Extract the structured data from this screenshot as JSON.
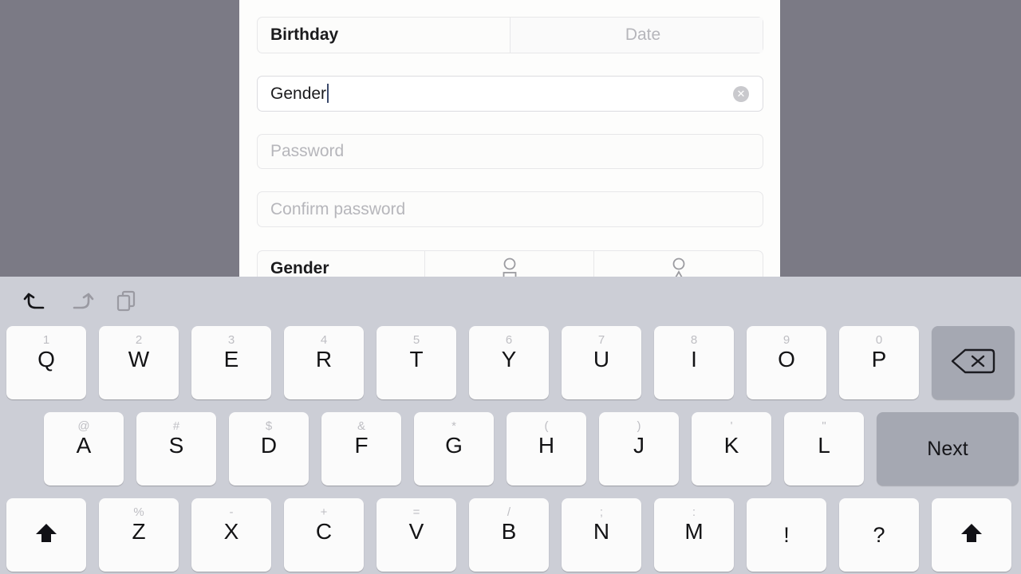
{
  "backdrop": {
    "color": "#7b7a85"
  },
  "form": {
    "panel_bg": "#fdfdfc",
    "birthday": {
      "label": "Birthday",
      "date_placeholder": "Date"
    },
    "gender_input": {
      "value": "Gender",
      "clear_icon": "clear-circle-icon",
      "clear_glyph": "✕"
    },
    "password": {
      "placeholder": "Password"
    },
    "confirm_password": {
      "placeholder": "Confirm password"
    },
    "gender_select": {
      "label": "Gender",
      "options": [
        {
          "icon": "male-person-icon"
        },
        {
          "icon": "female-person-icon"
        }
      ]
    }
  },
  "keyboard": {
    "bg": "#ccced6",
    "toolbar": [
      {
        "name": "undo-icon",
        "enabled": true
      },
      {
        "name": "redo-icon",
        "enabled": false
      },
      {
        "name": "paste-icon",
        "enabled": false
      }
    ],
    "rows": [
      {
        "name": "row-1",
        "keys": [
          {
            "main": "Q",
            "hint": "1"
          },
          {
            "main": "W",
            "hint": "2"
          },
          {
            "main": "E",
            "hint": "3"
          },
          {
            "main": "R",
            "hint": "4"
          },
          {
            "main": "T",
            "hint": "5"
          },
          {
            "main": "Y",
            "hint": "6"
          },
          {
            "main": "U",
            "hint": "7"
          },
          {
            "main": "I",
            "hint": "8"
          },
          {
            "main": "O",
            "hint": "9"
          },
          {
            "main": "P",
            "hint": "0"
          },
          {
            "main": "",
            "hint": "",
            "icon": "backspace-icon",
            "gray": true
          }
        ]
      },
      {
        "name": "row-2",
        "keys": [
          {
            "main": "A",
            "hint": "@"
          },
          {
            "main": "S",
            "hint": "#"
          },
          {
            "main": "D",
            "hint": "$"
          },
          {
            "main": "F",
            "hint": "&"
          },
          {
            "main": "G",
            "hint": "*"
          },
          {
            "main": "H",
            "hint": "("
          },
          {
            "main": "J",
            "hint": ")"
          },
          {
            "main": "K",
            "hint": "'"
          },
          {
            "main": "L",
            "hint": "\""
          },
          {
            "main": "Next",
            "hint": "",
            "gray": true,
            "wide": true
          }
        ]
      },
      {
        "name": "row-3",
        "keys": [
          {
            "main": "",
            "hint": "",
            "icon": "shift-icon"
          },
          {
            "main": "Z",
            "hint": "%"
          },
          {
            "main": "X",
            "hint": "-"
          },
          {
            "main": "C",
            "hint": "+"
          },
          {
            "main": "V",
            "hint": "="
          },
          {
            "main": "B",
            "hint": "/"
          },
          {
            "main": "N",
            "hint": ";"
          },
          {
            "main": "M",
            "hint": ":"
          },
          {
            "main": "!",
            "hint": ""
          },
          {
            "main": "?",
            "hint": ""
          },
          {
            "main": "",
            "hint": "",
            "icon": "shift-icon"
          }
        ]
      }
    ]
  }
}
